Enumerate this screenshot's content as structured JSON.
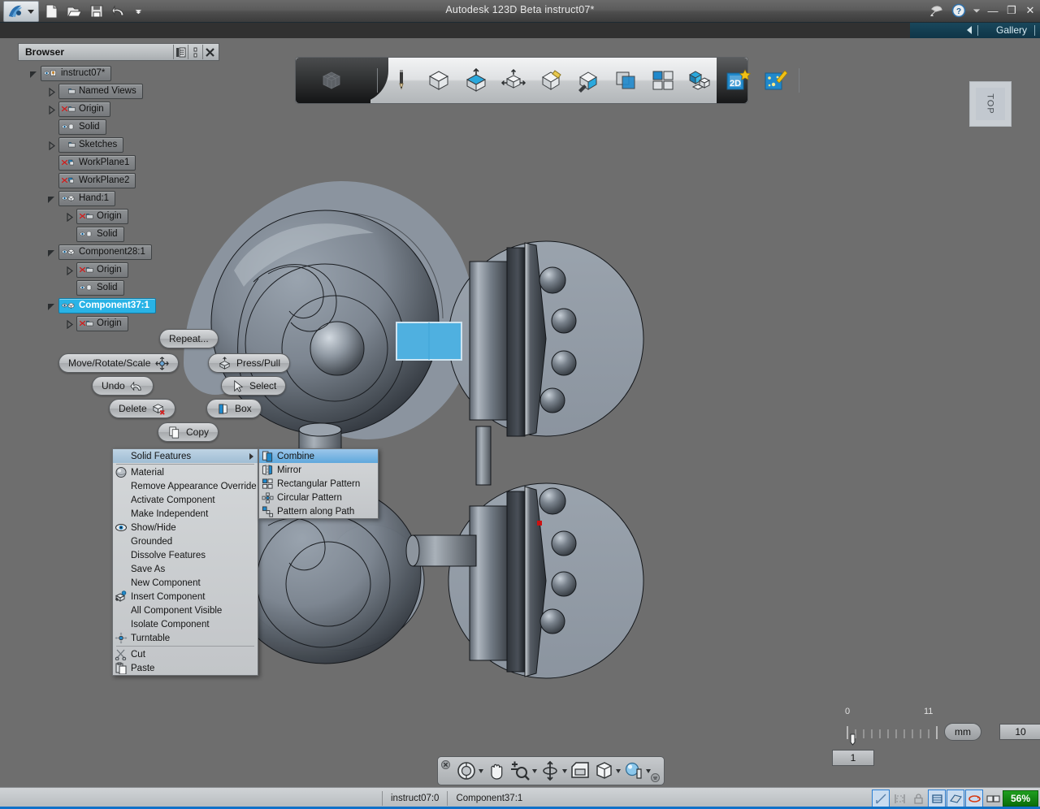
{
  "app": {
    "title": "Autodesk 123D Beta",
    "document": "instruct07*",
    "title_full": "Autodesk 123D Beta    instruct07*"
  },
  "titlebar": {
    "app_menu_icon": "123d-logo-icon",
    "quick_access": [
      {
        "name": "new-document-icon",
        "label": "New"
      },
      {
        "name": "open-document-icon",
        "label": "Open"
      },
      {
        "name": "save-icon",
        "label": "Save"
      },
      {
        "name": "undo-icon",
        "label": "Undo"
      },
      {
        "name": "customize-dropdown-icon",
        "label": "Customize Quick Access Toolbar"
      }
    ],
    "right_icons": [
      {
        "name": "satellite-dish-icon",
        "label": "Connect"
      },
      {
        "name": "help-icon",
        "label": "Help"
      },
      {
        "name": "help-dropdown-icon",
        "label": "Help options"
      }
    ],
    "window_buttons": {
      "minimize": "—",
      "restore": "❐",
      "close": "✕"
    }
  },
  "gallery_bar": {
    "label": "Gallery",
    "collapse_icon": "left-arrow-icon"
  },
  "browser": {
    "title": "Browser",
    "header_buttons": [
      {
        "name": "browser-filter-icon",
        "label": "Filter"
      },
      {
        "name": "browser-resize-icon",
        "label": "Resize"
      },
      {
        "name": "browser-close-icon",
        "label": "Close"
      }
    ],
    "tree": [
      {
        "label": "instruct07*",
        "indent": 0,
        "twisty": "expanded",
        "icon": "eye-pin-icon",
        "selected": false
      },
      {
        "label": "Named Views",
        "indent": 1,
        "twisty": "collapsed",
        "icon": "folder-icon",
        "selected": false
      },
      {
        "label": "Origin",
        "indent": 1,
        "twisty": "collapsed",
        "icon": "hidden-folder-icon",
        "selected": false
      },
      {
        "label": "Solid",
        "indent": 1,
        "twisty": "none",
        "icon": "eye-cylinder-icon",
        "selected": false
      },
      {
        "label": "Sketches",
        "indent": 1,
        "twisty": "collapsed",
        "icon": "folder-icon",
        "selected": false
      },
      {
        "label": "WorkPlane1",
        "indent": 1,
        "twisty": "none",
        "icon": "hidden-workplane-icon",
        "selected": false
      },
      {
        "label": "WorkPlane2",
        "indent": 1,
        "twisty": "none",
        "icon": "hidden-workplane-icon",
        "selected": false
      },
      {
        "label": "Hand:1",
        "indent": 1,
        "twisty": "expanded",
        "icon": "eye-cube-icon",
        "selected": false
      },
      {
        "label": "Origin",
        "indent": 2,
        "twisty": "collapsed",
        "icon": "hidden-folder-icon",
        "selected": false
      },
      {
        "label": "Solid",
        "indent": 2,
        "twisty": "none",
        "icon": "eye-cylinder-icon",
        "selected": false
      },
      {
        "label": "Component28:1",
        "indent": 1,
        "twisty": "expanded",
        "icon": "eye-cube-icon",
        "selected": false
      },
      {
        "label": "Origin",
        "indent": 2,
        "twisty": "collapsed",
        "icon": "hidden-folder-icon",
        "selected": false
      },
      {
        "label": "Solid",
        "indent": 2,
        "twisty": "none",
        "icon": "eye-cylinder-icon",
        "selected": false
      },
      {
        "label": "Component37:1",
        "indent": 1,
        "twisty": "expanded",
        "icon": "eye-cube-icon",
        "selected": true
      },
      {
        "label": "Origin",
        "indent": 2,
        "twisty": "collapsed",
        "icon": "hidden-folder-icon",
        "selected": false
      }
    ]
  },
  "ribbon": {
    "home_icon": "cube-grid-icon",
    "tools": [
      {
        "name": "sketch-pencil-icon",
        "label": "Sketch"
      },
      {
        "name": "primitive-cube-icon",
        "label": "Primitives"
      },
      {
        "name": "press-pull-icon",
        "label": "Press/Pull"
      },
      {
        "name": "modify-move-icon",
        "label": "Modify"
      },
      {
        "name": "construct-icon",
        "label": "Construct"
      },
      {
        "name": "sketch-edit-icon",
        "label": "Sketch Edit"
      },
      {
        "name": "combine-icon",
        "label": "Combine"
      },
      {
        "name": "pattern-icon",
        "label": "Pattern"
      },
      {
        "name": "grouping-icon",
        "label": "Grouping"
      },
      {
        "name": "2d-drawing-icon",
        "label": "2D"
      },
      {
        "name": "smart-effects-icon",
        "label": "Effects"
      }
    ]
  },
  "view_cube": {
    "label": "TOP"
  },
  "marking_menu": {
    "items": [
      {
        "name": "repeat-button",
        "label": "Repeat...",
        "icon": "none",
        "icon_side": "none"
      },
      {
        "name": "move-rotate-scale-button",
        "label": "Move/Rotate/Scale",
        "icon": "move-gizmo-icon",
        "icon_side": "right"
      },
      {
        "name": "press-pull-button",
        "label": "Press/Pull",
        "icon": "press-pull-icon",
        "icon_side": "left"
      },
      {
        "name": "undo-button",
        "label": "Undo",
        "icon": "undo-arrow-icon",
        "icon_side": "right"
      },
      {
        "name": "select-button",
        "label": "Select",
        "icon": "select-cursor-icon",
        "icon_side": "left"
      },
      {
        "name": "delete-button",
        "label": "Delete",
        "icon": "delete-cube-icon",
        "icon_side": "right"
      },
      {
        "name": "box-button",
        "label": "Box",
        "icon": "box-icon",
        "icon_side": "left"
      },
      {
        "name": "copy-button",
        "label": "Copy",
        "icon": "copy-pages-icon",
        "icon_side": "left"
      }
    ]
  },
  "context_menu": {
    "items": [
      {
        "label": "Solid Features",
        "icon": "none",
        "submenu": true,
        "highlighted": true,
        "divider_after": true
      },
      {
        "label": "Material",
        "icon": "material-sphere-icon",
        "submenu": false,
        "highlighted": false,
        "divider_after": false
      },
      {
        "label": "Remove Appearance Override",
        "icon": "none",
        "submenu": false,
        "highlighted": false,
        "divider_after": false
      },
      {
        "label": "Activate Component",
        "icon": "none",
        "submenu": false,
        "highlighted": false,
        "divider_after": false
      },
      {
        "label": "Make Independent",
        "icon": "none",
        "submenu": false,
        "highlighted": false,
        "divider_after": false
      },
      {
        "label": "Show/Hide",
        "icon": "eye-icon",
        "submenu": false,
        "highlighted": false,
        "divider_after": false
      },
      {
        "label": "Grounded",
        "icon": "none",
        "submenu": false,
        "highlighted": false,
        "divider_after": false
      },
      {
        "label": "Dissolve Features",
        "icon": "none",
        "submenu": false,
        "highlighted": false,
        "divider_after": false
      },
      {
        "label": "Save As",
        "icon": "none",
        "submenu": false,
        "highlighted": false,
        "divider_after": false
      },
      {
        "label": "New Component",
        "icon": "none",
        "submenu": false,
        "highlighted": false,
        "divider_after": false
      },
      {
        "label": "Insert Component",
        "icon": "insert-component-icon",
        "submenu": false,
        "highlighted": false,
        "divider_after": false
      },
      {
        "label": "All Component Visible",
        "icon": "none",
        "submenu": false,
        "highlighted": false,
        "divider_after": false
      },
      {
        "label": "Isolate Component",
        "icon": "none",
        "submenu": false,
        "highlighted": false,
        "divider_after": false
      },
      {
        "label": "Turntable",
        "icon": "turntable-icon",
        "submenu": false,
        "highlighted": false,
        "divider_after": true
      },
      {
        "label": "Cut",
        "icon": "scissors-icon",
        "submenu": false,
        "highlighted": false,
        "divider_after": false
      },
      {
        "label": "Paste",
        "icon": "clipboard-icon",
        "submenu": false,
        "highlighted": false,
        "divider_after": false
      }
    ]
  },
  "submenu": {
    "items": [
      {
        "label": "Combine",
        "icon": "combine-icon",
        "highlighted": true
      },
      {
        "label": "Mirror",
        "icon": "mirror-icon",
        "highlighted": false
      },
      {
        "label": "Rectangular Pattern",
        "icon": "rectangular-pattern-icon",
        "highlighted": false
      },
      {
        "label": "Circular Pattern",
        "icon": "circular-pattern-icon",
        "highlighted": false
      },
      {
        "label": "Pattern along Path",
        "icon": "pattern-along-path-icon",
        "highlighted": false
      }
    ]
  },
  "scale_widget": {
    "tick_start": "0",
    "tick_end": "11",
    "unit": "mm",
    "grid_value": "10",
    "snap_value": "1"
  },
  "nav_bar": {
    "items": [
      {
        "name": "orbit-tool",
        "label": "Orbit",
        "icon": "orbit-icon",
        "has_caret": true
      },
      {
        "name": "pan-tool",
        "label": "Pan",
        "icon": "hand-icon",
        "has_caret": false
      },
      {
        "name": "zoom-tool",
        "label": "Zoom",
        "icon": "zoom-magnifier-icon",
        "has_caret": true
      },
      {
        "name": "orbit-free-tool",
        "label": "Free Orbit",
        "icon": "free-orbit-icon",
        "has_caret": true
      },
      {
        "name": "view-tool",
        "label": "Views",
        "icon": "view-window-icon",
        "has_caret": false
      },
      {
        "name": "display-tool",
        "label": "Display",
        "icon": "display-cube-icon",
        "has_caret": true
      },
      {
        "name": "light-tool",
        "label": "Lighting",
        "icon": "light-sphere-icon",
        "has_caret": true
      }
    ],
    "close_icon": "close-small-icon",
    "options_icon": "options-dots-icon"
  },
  "status_bar": {
    "document": "instruct07:0",
    "active_component": "Component37:1",
    "toggles": [
      {
        "name": "snap-toggle",
        "icon": "snap-angle-icon",
        "active": true
      },
      {
        "name": "measure-toggle",
        "icon": "measure-icon",
        "active": false
      },
      {
        "name": "lock-toggle",
        "icon": "lock-icon",
        "active": false
      },
      {
        "name": "grid-toggle",
        "icon": "grid-snap-icon",
        "active": true
      },
      {
        "name": "plane-toggle",
        "icon": "workplane-icon",
        "active": true
      },
      {
        "name": "orbit-toggle",
        "icon": "orbit-red-icon",
        "active": true
      },
      {
        "name": "view-toggle",
        "icon": "dual-view-icon",
        "active": false
      }
    ],
    "zoom_level": "56%"
  },
  "colors": {
    "accent_blue": "#29b3e6",
    "selection_blue": "#4fb0e0",
    "canvas_bg": "#6e6e6e",
    "teal_bar": "#19475c",
    "zoom_green": "#1f9e1f",
    "status_blue": "#1071c8"
  }
}
